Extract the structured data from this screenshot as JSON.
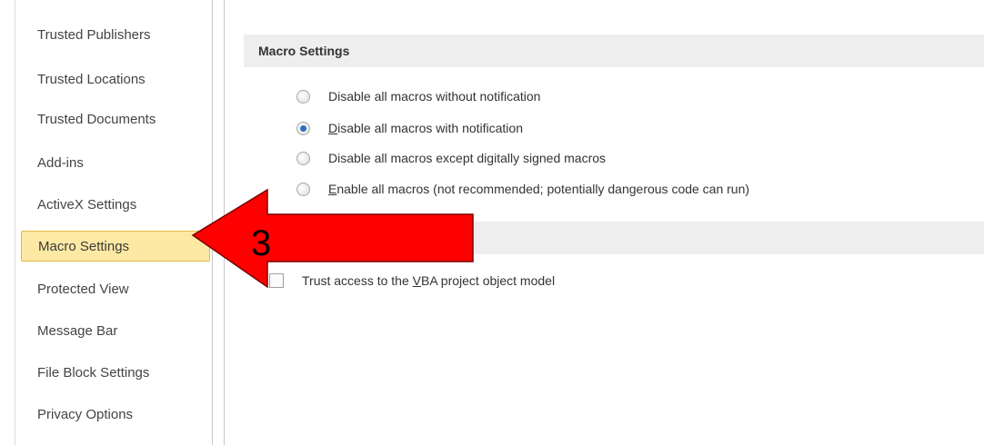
{
  "sidebar": {
    "items": [
      {
        "label": "Trusted Publishers"
      },
      {
        "label": "Trusted Locations"
      },
      {
        "label": "Trusted Documents"
      },
      {
        "label": "Add-ins"
      },
      {
        "label": "ActiveX Settings"
      },
      {
        "label": "Macro Settings",
        "selected": true
      },
      {
        "label": "Protected View"
      },
      {
        "label": "Message Bar"
      },
      {
        "label": "File Block Settings"
      },
      {
        "label": "Privacy Options"
      }
    ]
  },
  "macro_section": {
    "header": "Macro Settings",
    "options": [
      {
        "pre": "Disable all macros without notification",
        "u": "",
        "post": "",
        "checked": false
      },
      {
        "pre": "",
        "u": "D",
        "post": "isable all macros with notification",
        "checked": true
      },
      {
        "pre": "Disable all macros except digitally signed macros",
        "u": "",
        "post": "",
        "checked": false
      },
      {
        "pre": "",
        "u": "E",
        "post": "nable all macros (not recommended; potentially dangerous code can run)",
        "checked": false
      }
    ]
  },
  "vba_section": {
    "checkbox_pre": "Trust access to the ",
    "checkbox_u": "V",
    "checkbox_post": "BA project object model",
    "checked": false
  },
  "annotation": {
    "number": "3",
    "arrow_color": "#ff0000"
  }
}
